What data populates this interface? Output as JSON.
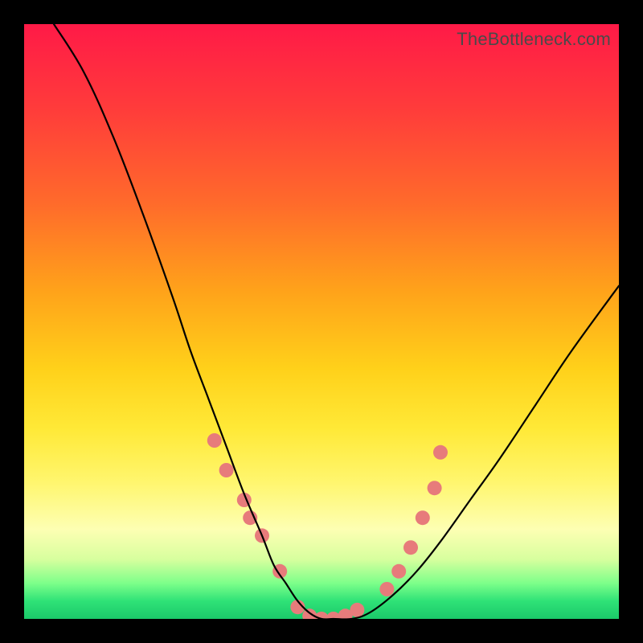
{
  "watermark": "TheBottleneck.com",
  "chart_data": {
    "type": "line",
    "title": "",
    "xlabel": "",
    "ylabel": "",
    "xlim": [
      0,
      100
    ],
    "ylim": [
      0,
      100
    ],
    "description": "V-shaped bottleneck curve over rainbow gradient background. Y axis represents bottleneck percentage (top=100 bad, bottom=0 good). Left branch descends steeply from top-left, flat zero region around center-left, right branch rises and exits near upper right around y≈55.",
    "series": [
      {
        "name": "bottleneck_curve",
        "x": [
          5,
          10,
          15,
          20,
          25,
          28,
          31,
          34,
          37,
          40,
          42,
          44,
          46,
          48,
          50,
          52,
          55,
          58,
          62,
          66,
          70,
          75,
          80,
          86,
          92,
          100
        ],
        "y": [
          100,
          92,
          81,
          68,
          54,
          45,
          37,
          29,
          21,
          14,
          9,
          6,
          3,
          1,
          0,
          0,
          0,
          1,
          4,
          8,
          13,
          20,
          27,
          36,
          45,
          56
        ]
      }
    ],
    "markers": {
      "note": "Salmon dot markers placed along both arms of the V in the low region",
      "points": [
        {
          "x": 32,
          "y": 30
        },
        {
          "x": 34,
          "y": 25
        },
        {
          "x": 37,
          "y": 20
        },
        {
          "x": 38,
          "y": 17
        },
        {
          "x": 40,
          "y": 14
        },
        {
          "x": 43,
          "y": 8
        },
        {
          "x": 46,
          "y": 2
        },
        {
          "x": 48,
          "y": 0.5
        },
        {
          "x": 50,
          "y": 0
        },
        {
          "x": 52,
          "y": 0
        },
        {
          "x": 54,
          "y": 0.5
        },
        {
          "x": 56,
          "y": 1.5
        },
        {
          "x": 61,
          "y": 5
        },
        {
          "x": 63,
          "y": 8
        },
        {
          "x": 65,
          "y": 12
        },
        {
          "x": 67,
          "y": 17
        },
        {
          "x": 69,
          "y": 22
        },
        {
          "x": 70,
          "y": 28
        }
      ],
      "color": "#e77b7b",
      "radius": 9
    },
    "curve_color": "#000000",
    "curve_width": 2.2
  }
}
